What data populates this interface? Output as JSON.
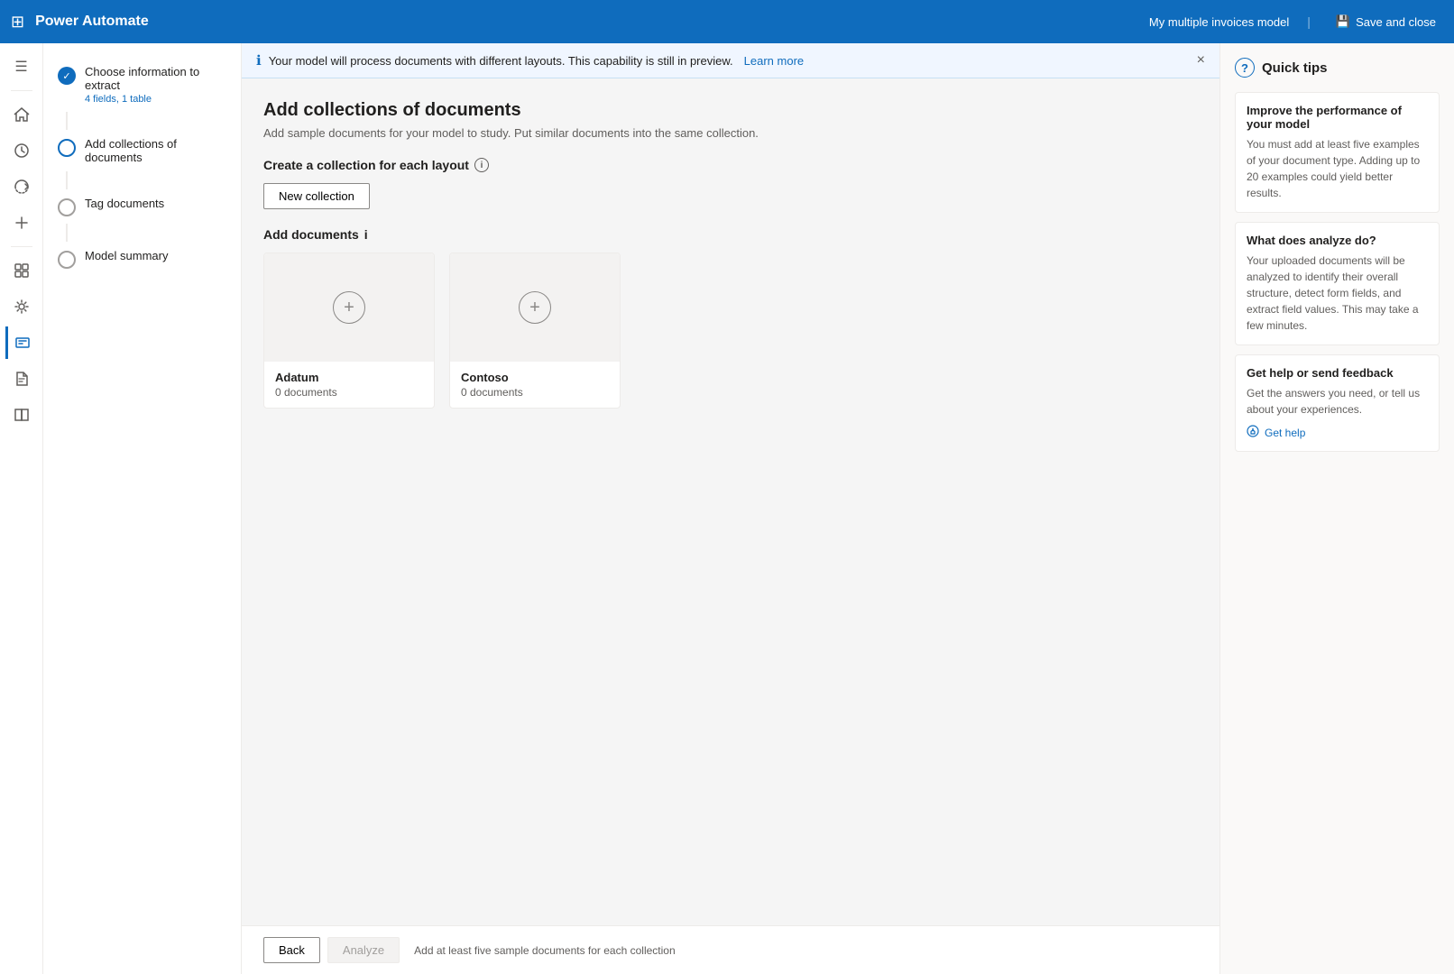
{
  "topbar": {
    "grid_icon": "⊞",
    "title": "Power Automate",
    "model_name": "My multiple invoices model",
    "divider": "|",
    "save_close_label": "Save and close",
    "save_icon": "💾"
  },
  "sidebar_icons": [
    {
      "name": "menu-icon",
      "icon": "☰"
    },
    {
      "name": "home-icon",
      "icon": "⌂"
    },
    {
      "name": "activity-icon",
      "icon": "◷"
    },
    {
      "name": "flow-icon",
      "icon": "↻"
    },
    {
      "name": "add-icon",
      "icon": "+"
    },
    {
      "name": "apps-icon",
      "icon": "⊞"
    },
    {
      "name": "pin-icon",
      "icon": "📌"
    },
    {
      "name": "alert-icon",
      "icon": "🔔"
    },
    {
      "name": "document-icon",
      "icon": "📄"
    },
    {
      "name": "ai-icon",
      "icon": "✦"
    },
    {
      "name": "book-icon",
      "icon": "📖"
    }
  ],
  "steps": [
    {
      "id": "choose-info",
      "label": "Choose information to extract",
      "sublabel": "4 fields, 1 table",
      "status": "completed"
    },
    {
      "id": "add-collections",
      "label": "Add collections of documents",
      "sublabel": "",
      "status": "active"
    },
    {
      "id": "tag-documents",
      "label": "Tag documents",
      "sublabel": "",
      "status": "inactive"
    },
    {
      "id": "model-summary",
      "label": "Model summary",
      "sublabel": "",
      "status": "inactive"
    }
  ],
  "info_banner": {
    "text": "Your model will process documents with different layouts. This capability is still in preview.",
    "learn_more_label": "Learn more",
    "close_label": "×"
  },
  "page": {
    "title": "Add collections of documents",
    "subtitle": "Add sample documents for your model to study. Put similar documents into the same collection.",
    "create_collection_label": "Create a collection for each layout",
    "new_collection_btn": "New collection",
    "add_documents_label": "Add documents"
  },
  "collections": [
    {
      "name": "Adatum",
      "doc_count": "0 documents"
    },
    {
      "name": "Contoso",
      "doc_count": "0 documents"
    }
  ],
  "bottom_bar": {
    "back_label": "Back",
    "analyze_label": "Analyze",
    "hint": "Add at least five sample documents for each collection"
  },
  "quick_tips": {
    "header_label": "Quick tips",
    "tips": [
      {
        "title": "Improve the performance of your model",
        "text": "You must add at least five examples of your document type. Adding up to 20 examples could yield better results."
      },
      {
        "title": "What does analyze do?",
        "text": "Your uploaded documents will be analyzed to identify their overall structure, detect form fields, and extract field values. This may take a few minutes."
      },
      {
        "title": "Get help or send feedback",
        "text": "Get the answers you need, or tell us about your experiences."
      }
    ],
    "get_help_label": "Get help"
  }
}
